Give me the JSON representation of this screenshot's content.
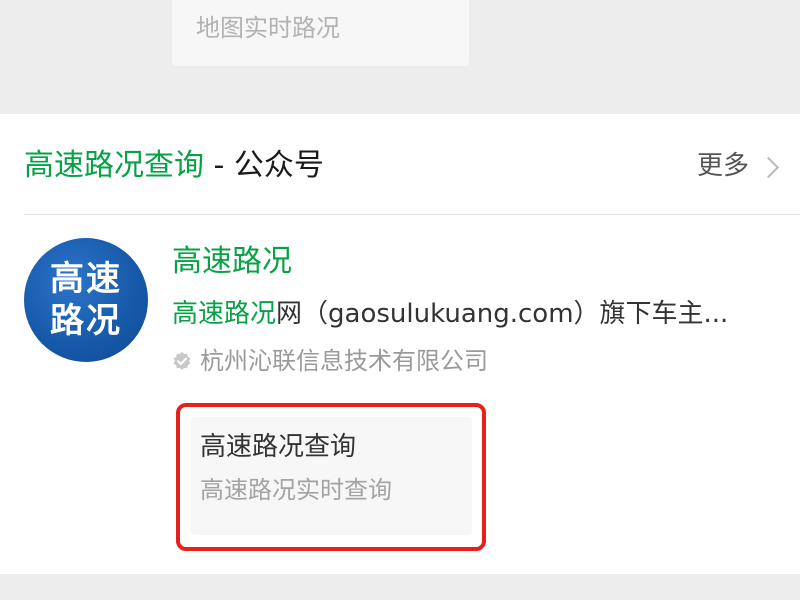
{
  "top_suggestion": {
    "label": "地图实时路况"
  },
  "section": {
    "title_keyword": "高速路况查询",
    "title_suffix": " - 公众号",
    "more_label": "更多",
    "more_icon": "chevron-right-icon"
  },
  "account": {
    "avatar_line1": "高速",
    "avatar_line2": "路况",
    "avatar_color": "#1658a8",
    "name": "高速路况",
    "desc_keyword": "高速路况",
    "desc_rest": "网（gaosulukuang.com）旗下车主...",
    "verified_icon": "verified-badge-icon",
    "company": "杭州沁联信息技术有限公司"
  },
  "menu": {
    "title": "高速路况查询",
    "subtitle": "高速路况实时查询",
    "highlight_color": "#e8201c"
  },
  "colors": {
    "keyword_green": "#07a146",
    "background": "#ededed"
  }
}
